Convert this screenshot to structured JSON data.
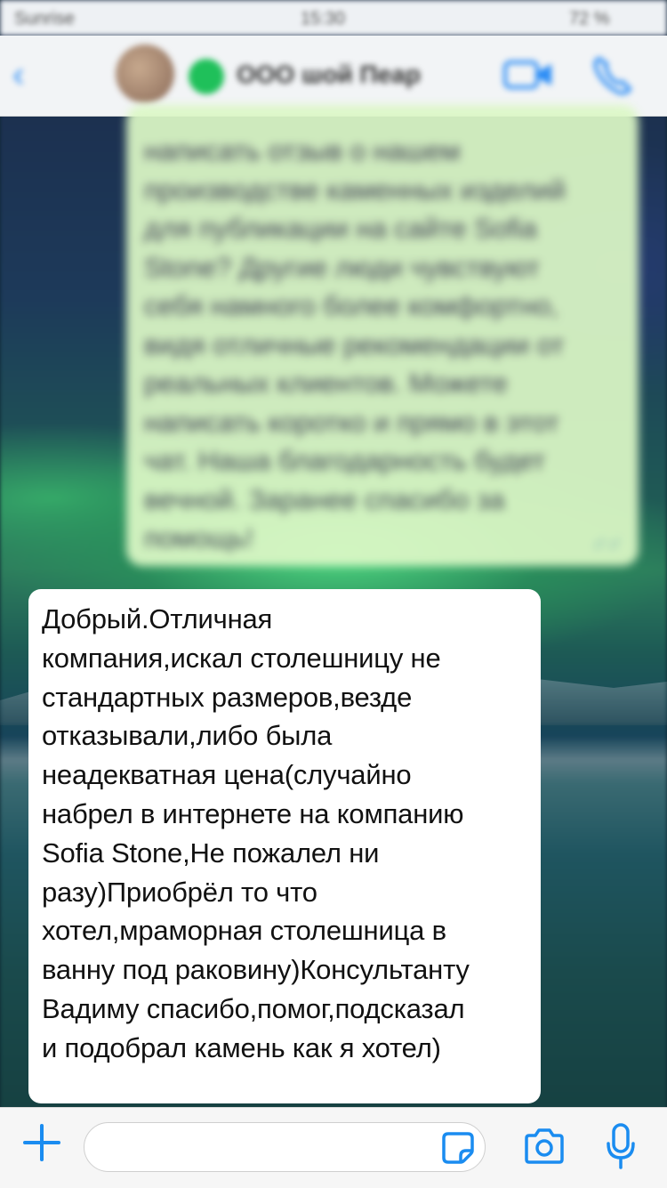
{
  "status_bar": {
    "carrier": "Sunrise",
    "time": "15:30",
    "battery": "72 %"
  },
  "chat_header": {
    "back_icon": "chevron-left-icon",
    "contact_name": "ООО шой Пеар",
    "video_icon": "video-camera-icon",
    "call_icon": "phone-icon"
  },
  "messages": [
    {
      "direction": "outgoing",
      "blurred": true,
      "text": "написать отзыв о нашем\nпроизводстве каменных изделий\nдля публикации на сайте Sofia\nStone? Другие люди чувствуют\nсебя намного более комфортно,\nвидя отличные рекомендации от\nреальных клиентов. Можете\nнаписать коротко и прямо в этот\nчат. Наша благодарность будет\nвечной. Заранее спасибо за\nпомощь!"
    },
    {
      "direction": "incoming",
      "blurred": false,
      "text": "Добрый.Отличная\nкомпания,искал столешницу не\nстандартных размеров,везде\nотказывали,либо была\nнеадекватная цена(случайно\nнабрел в интернете на компанию\nSofia Stone,Не пожалел ни\nразу)Приобрёл то что\nхотел,мраморная столешница в\nванну под раковину)Консультанту\nВадиму спасибо,помог,подсказал\nи подобрал камень как я хотел)"
    }
  ],
  "input_bar": {
    "plus_icon": "plus-icon",
    "placeholder": "",
    "sticker_icon": "sticker-icon",
    "camera_icon": "camera-icon",
    "mic_icon": "microphone-icon"
  },
  "colors": {
    "accent": "#1a8cf0",
    "outgoing_bubble": "#dcf8c6",
    "incoming_bubble": "#ffffff",
    "online": "#1fc05a"
  }
}
